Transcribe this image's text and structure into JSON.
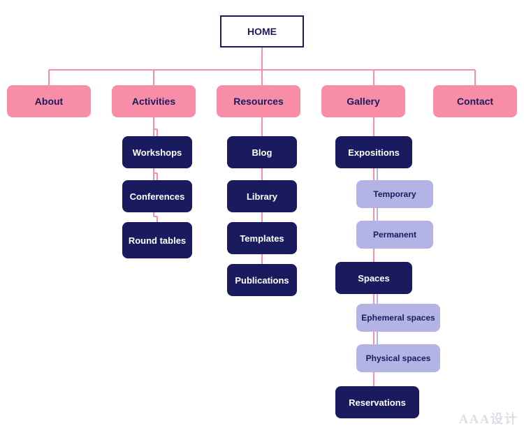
{
  "nodes": {
    "home": {
      "label": "HOME"
    },
    "about": {
      "label": "About"
    },
    "activities": {
      "label": "Activities"
    },
    "resources": {
      "label": "Resources"
    },
    "gallery": {
      "label": "Gallery"
    },
    "contact": {
      "label": "Contact"
    },
    "workshops": {
      "label": "Workshops"
    },
    "conferences": {
      "label": "Conferences"
    },
    "roundtables": {
      "label": "Round tables"
    },
    "blog": {
      "label": "Blog"
    },
    "library": {
      "label": "Library"
    },
    "templates": {
      "label": "Templates"
    },
    "publications": {
      "label": "Publications"
    },
    "expositions": {
      "label": "Expositions"
    },
    "temporary": {
      "label": "Temporary"
    },
    "permanent": {
      "label": "Permanent"
    },
    "spaces": {
      "label": "Spaces"
    },
    "ephemeral": {
      "label": "Ephemeral spaces"
    },
    "physical": {
      "label": "Physical spaces"
    },
    "reservations": {
      "label": "Reservations"
    }
  },
  "watermark": "AAA设计"
}
